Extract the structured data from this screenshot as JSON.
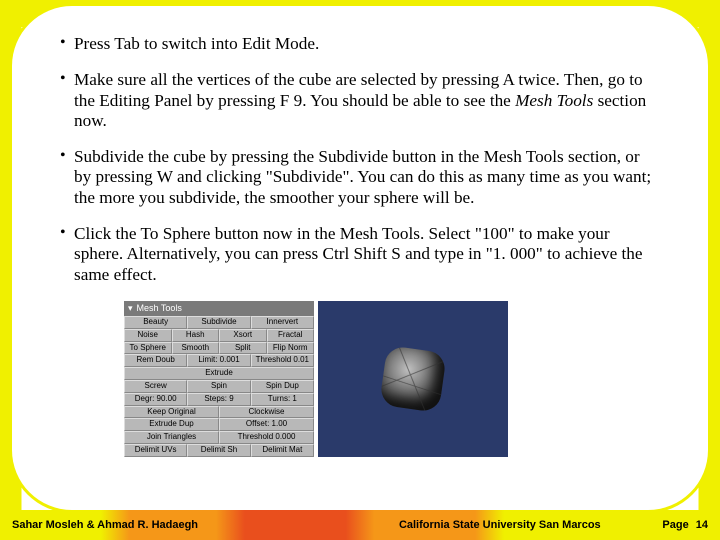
{
  "bullets": [
    {
      "text": "Press Tab to switch into Edit Mode."
    },
    {
      "text": "Make sure all the vertices of the cube are selected by pressing A twice. Then, go to the Editing Panel by pressing F 9. You should be able to see the ",
      "emph": "Mesh Tools",
      "tail": " section now."
    },
    {
      "text": "Subdivide the cube by pressing the Subdivide button in the Mesh Tools section, or by pressing W and clicking \"Subdivide\". You can do this as many time as you want; the more you subdivide, the smoother your sphere will be."
    },
    {
      "text": "Click the To Sphere button now in the Mesh Tools. Select \"100\" to make your sphere. Alternatively, you can press Ctrl Shift S and type in \"1. 000\" to achieve the same effect."
    }
  ],
  "panel": {
    "title": "Mesh Tools",
    "rows": [
      [
        "Beauty",
        "Subdivide",
        "Innervert"
      ],
      [
        "Noise",
        "Hash",
        "Xsort",
        "Fractal"
      ],
      [
        "To Sphere",
        "Smooth",
        "Split",
        "Flip Norm"
      ],
      [
        "Rem Doub",
        "Limit: 0.001",
        "Threshold 0.01"
      ],
      [
        "Extrude"
      ],
      [
        "Screw",
        "Spin",
        "Spin Dup"
      ],
      [
        "Degr: 90.00",
        "Steps: 9",
        "Turns: 1"
      ],
      [
        "Keep Original",
        "Clockwise"
      ],
      [
        "Extrude Dup",
        "Offset: 1.00"
      ],
      [
        "Join Triangles",
        "Threshold 0.000"
      ],
      [
        "Delimit UVs",
        "Delimit Sh",
        "Delimit Mat"
      ]
    ]
  },
  "footer": {
    "left": "Sahar Mosleh & Ahmad R. Hadaegh",
    "center": "California State University San Marcos",
    "right_label": "Page",
    "page_number": "14"
  }
}
